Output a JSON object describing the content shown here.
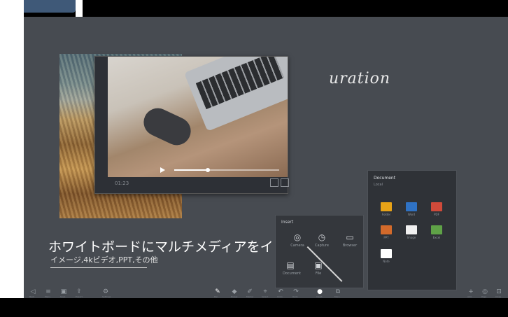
{
  "whiteboard": {
    "handwriting": "uration"
  },
  "video_window": {
    "caption": "01:23"
  },
  "headline": {
    "title": "ホワイトボードにマルチメディアをインポート",
    "subtitle": "イメージ,4kビデオ,PPT,その他"
  },
  "insert_panel": {
    "title": "Insert",
    "items": [
      {
        "label": "Camera",
        "icon": "camera-icon"
      },
      {
        "label": "Capture",
        "icon": "capture-icon"
      },
      {
        "label": "Browser",
        "icon": "browser-icon"
      },
      {
        "label": "Document",
        "icon": "document-icon"
      },
      {
        "label": "File",
        "icon": "file-icon"
      }
    ]
  },
  "doc_panel": {
    "title": "Document",
    "subtitle": "Local",
    "items": [
      {
        "label": "Folder",
        "color": "#e8a317"
      },
      {
        "label": "Word",
        "color": "#2f72c4"
      },
      {
        "label": "PDF",
        "color": "#d04a3a"
      },
      {
        "label": "PPT",
        "color": "#d36a2b"
      },
      {
        "label": "Image",
        "color": "#f0f0f0"
      },
      {
        "label": "Excel",
        "color": "#5fa247"
      },
      {
        "label": "Note",
        "color": "#ffffff"
      }
    ]
  },
  "toolbar": {
    "left": [
      "Back",
      "Menu",
      "Save",
      "Export",
      "Settings"
    ],
    "center": [
      "Pen",
      "Eraser",
      "Marker",
      "Select",
      "Undo",
      "Redo",
      "Insert",
      "More"
    ],
    "right": [
      "Add",
      "Page",
      "Close"
    ]
  },
  "colors": {
    "screen_bg": "#474b51",
    "panel_bg": "#34373c",
    "accent": "#3f5978"
  }
}
